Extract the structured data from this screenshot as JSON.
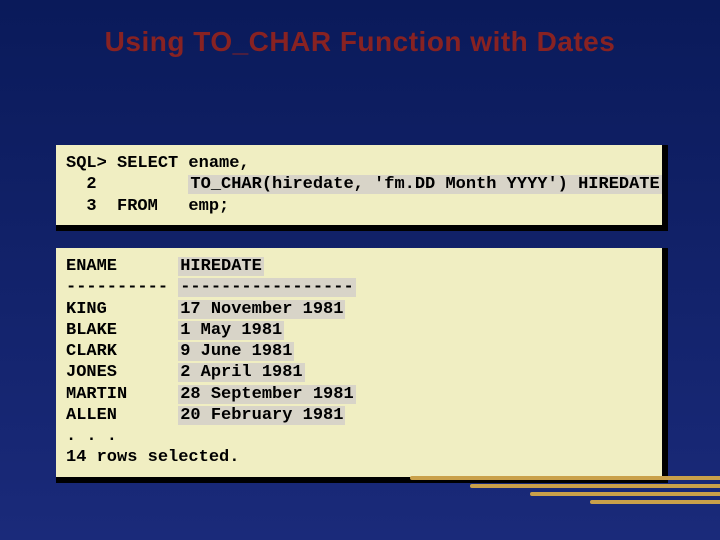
{
  "title": "Using TO_CHAR Function with Dates",
  "sql": {
    "line1": "SQL> SELECT ename,",
    "line2_pre": "  2         ",
    "line2_hl": "TO_CHAR(hiredate, 'fm.DD Month YYYY') HIREDATE",
    "line3": "  3  FROM   emp;"
  },
  "result": {
    "header_cols": "ENAME      ",
    "header_hl": "HIREDATE",
    "sep_cols": "---------- ",
    "sep_hl": "-----------------",
    "rows": [
      {
        "name": "KING       ",
        "date": "17 November 1981"
      },
      {
        "name": "BLAKE      ",
        "date": "1 May 1981"
      },
      {
        "name": "CLARK      ",
        "date": "9 June 1981"
      },
      {
        "name": "JONES      ",
        "date": "2 April 1981"
      },
      {
        "name": "MARTIN     ",
        "date": "28 September 1981"
      },
      {
        "name": "ALLEN      ",
        "date": "20 February 1981"
      }
    ],
    "ellipsis": ". . .",
    "footer": "14 rows selected."
  }
}
